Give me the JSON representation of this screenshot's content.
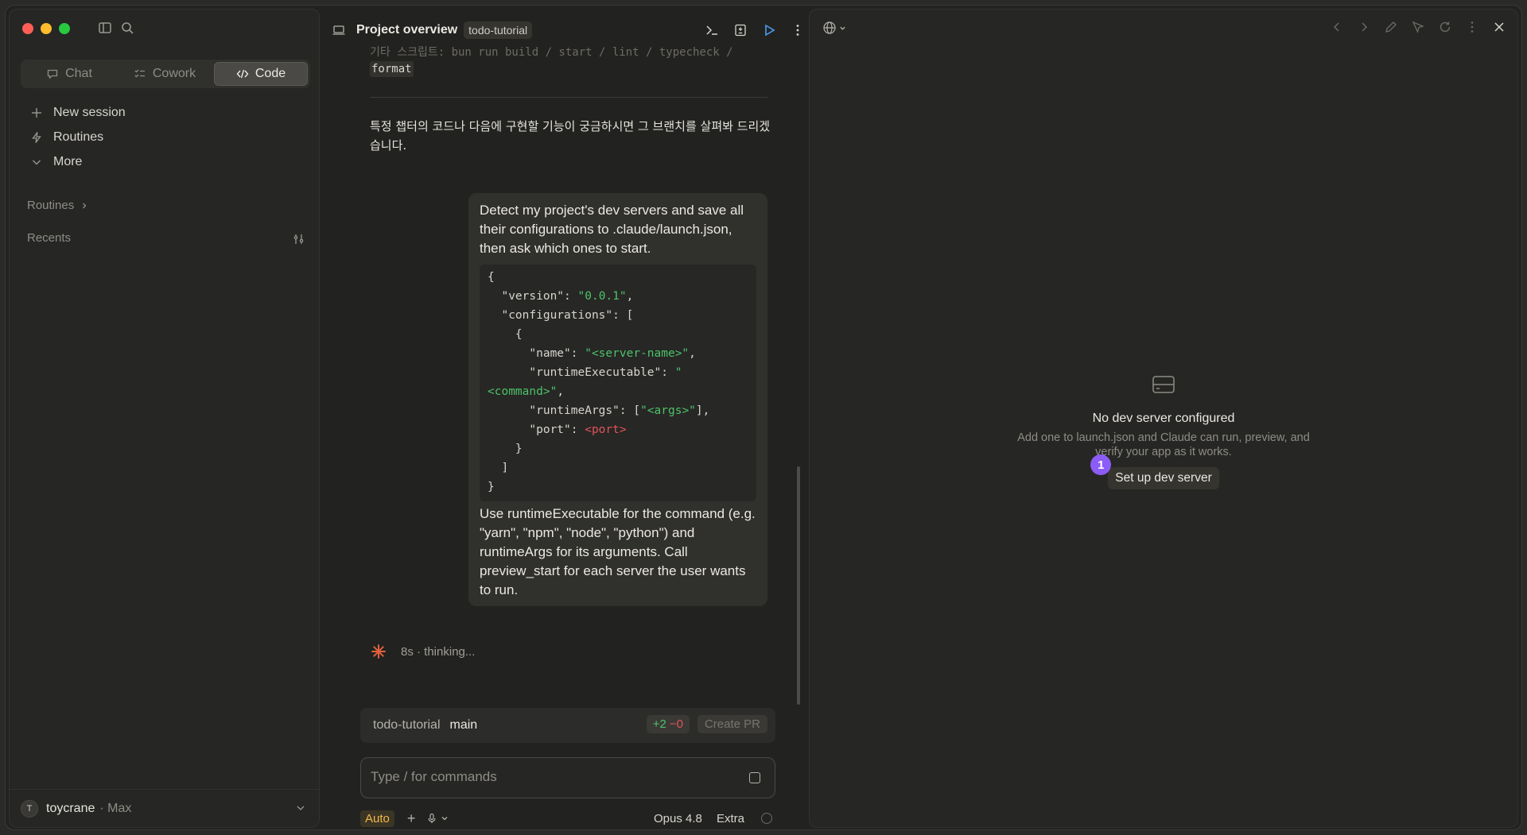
{
  "sidebar": {
    "modes": [
      {
        "label": "Chat",
        "icon": "chat-bubble-icon",
        "active": false
      },
      {
        "label": "Cowork",
        "icon": "checklist-icon",
        "active": false
      },
      {
        "label": "Code",
        "icon": "code-icon",
        "active": true
      }
    ],
    "nav": [
      {
        "label": "New session",
        "icon": "plus-icon"
      },
      {
        "label": "Routines",
        "icon": "bolt-icon"
      },
      {
        "label": "More",
        "icon": "chevron-down-icon"
      }
    ],
    "routines_label": "Routines",
    "recents_label": "Recents",
    "user": {
      "initial": "T",
      "name": "toycrane",
      "plan": "· Max"
    }
  },
  "chat": {
    "title": "Project overview",
    "repo": "todo-tutorial",
    "faded_line": "기타 스크립트: bun run build / start / lint / typecheck /",
    "format_chip": "format",
    "korean_text": "특정 챕터의 코드나 다음에 구현할 기능이 궁금하시면 그 브랜치를 살펴봐 드리겠습니다.",
    "user_message": {
      "intro": "Detect my project's dev servers and save all their configurations to .claude/launch.json, then ask which ones to start.",
      "outro": "Use runtimeExecutable for the command (e.g. \"yarn\", \"npm\", \"node\", \"python\") and runtimeArgs for its arguments. Call preview_start for each server the user wants to run."
    },
    "thinking": "8s · thinking..."
  },
  "status": {
    "repo": "todo-tutorial",
    "branch": "main",
    "additions": "+2",
    "deletions": "−0",
    "create_pr": "Create PR"
  },
  "composer": {
    "placeholder": "Type / for commands",
    "mode": "Auto",
    "plus": "+",
    "model": "Opus 4.8",
    "effort": "Extra"
  },
  "preview": {
    "empty_title": "No dev server configured",
    "empty_desc": "Add one to launch.json and Claude can run, preview, and verify your app as it works.",
    "setup_button": "Set up dev server",
    "badge": "1"
  },
  "colors": {
    "accent_purple": "#8b5cf6",
    "diff_add": "#4ec26a",
    "diff_del": "#e0545a",
    "auto_mode": "#f2b84b"
  }
}
